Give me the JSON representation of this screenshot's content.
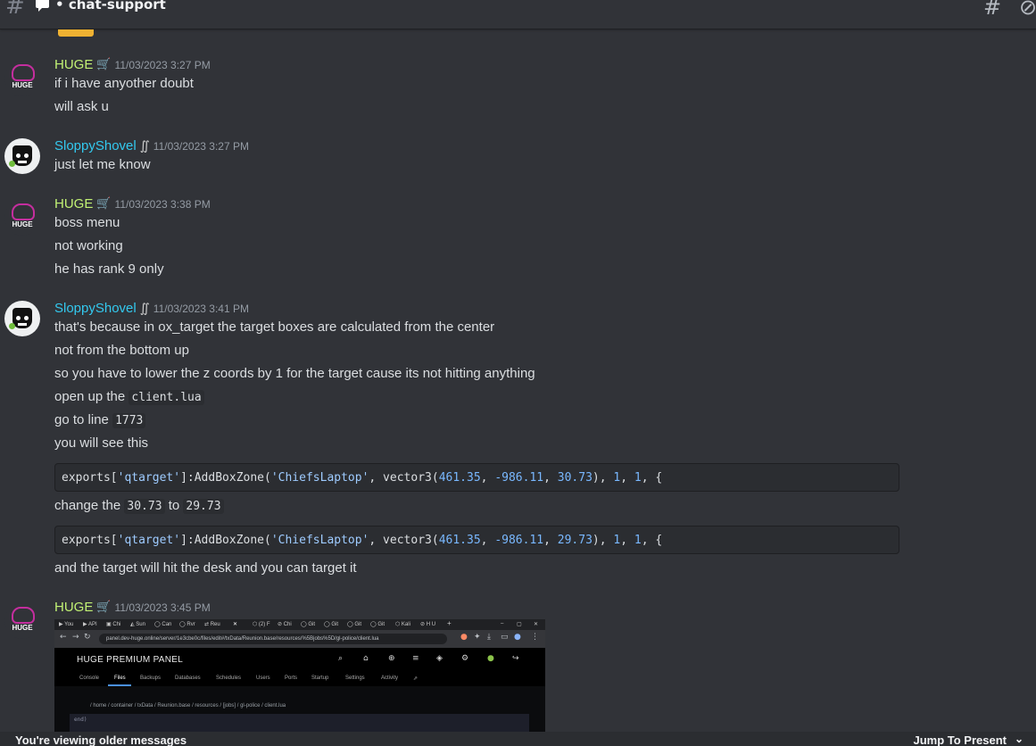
{
  "channel": {
    "name": "chat-support"
  },
  "messages": [
    {
      "author": "HUGE",
      "badge": "🛒",
      "timestamp": "11/03/2023 3:27 PM",
      "lines": [
        "if i have anyother doubt",
        "will ask u"
      ]
    },
    {
      "author": "SloppyShovel",
      "badge": "∬",
      "timestamp": "11/03/2023 3:27 PM",
      "lines": [
        "just let me know"
      ]
    },
    {
      "author": "HUGE",
      "badge": "🛒",
      "timestamp": "11/03/2023 3:38 PM",
      "lines": [
        "boss menu",
        "not working",
        "he has rank 9 only"
      ]
    },
    {
      "author": "SloppyShovel",
      "badge": "∬",
      "timestamp": "11/03/2023 3:41 PM",
      "lines": [
        "that's because in ox_target the target boxes are calculated from the center",
        "not from the bottom up",
        "so you have to lower the z coords by 1 for the target cause its not hitting  anything"
      ],
      "open_prefix": "open up the",
      "open_code": "client.lua",
      "goto_prefix": "go to line",
      "goto_code": "1773",
      "see_line": "you will see this",
      "code1": {
        "p1": "exports[",
        "s1": "'qtarget'",
        "p2": "]:AddBoxZone(",
        "s2": "'ChiefsLaptop'",
        "p3": ", vector3(",
        "n1": "461.35",
        "p4": ", ",
        "n2": "-986.11",
        "p5": ", ",
        "n3": "30.73",
        "p6": "), ",
        "n4": "1",
        "p7": ", ",
        "n5": "1",
        "p8": ", {"
      },
      "change_prefix": "change the",
      "change_from": "30.73",
      "change_mid": "to",
      "change_to": "29.73",
      "code2": {
        "p1": "exports[",
        "s1": "'qtarget'",
        "p2": "]:AddBoxZone(",
        "s2": "'ChiefsLaptop'",
        "p3": ", vector3(",
        "n1": "461.35",
        "p4": ", ",
        "n2": "-986.11",
        "p5": ", ",
        "n3": "29.73",
        "p6": "), ",
        "n4": "1",
        "p7": ", ",
        "n5": "1",
        "p8": ", {"
      },
      "final_line": "and the target will hit the desk and you can target it"
    },
    {
      "author": "HUGE",
      "badge": "🛒",
      "timestamp": "11/03/2023 3:45 PM",
      "screenshot": {
        "url": "panel.dev-huge.online/server/1e3cbe0c/files/edit#/txData/Reunion.base/resources/%5Bjobs%5D/gl-police/client.lua",
        "panel_title": "HUGE PREMIUM PANEL",
        "menu": [
          "Console",
          "Files",
          "Backups",
          "Databases",
          "Schedules",
          "Users",
          "Ports",
          "Startup",
          "Settings",
          "Activity"
        ],
        "breadcrumb": "/ home / container / txData / Reunion.base / resources / [jobs] / gl-police / client.lua",
        "editor_line": "end)"
      }
    }
  ],
  "avatar_text": "HUGE",
  "footer": {
    "older_label": "You're viewing older messages",
    "jump_label": "Jump To Present"
  },
  "colors": {
    "background": "#313338",
    "huge_name": "#c1f174",
    "sloppy_name": "#33c9ef",
    "timestamp": "#949ba4",
    "string": "#9ecbff",
    "number": "#79b8ff"
  },
  "icons": [
    "hash-icon",
    "chat-bubble-icon",
    "threads-icon",
    "notifications-off-icon",
    "shopping-cart-icon",
    "wave-icon",
    "chevron-down-icon"
  ]
}
